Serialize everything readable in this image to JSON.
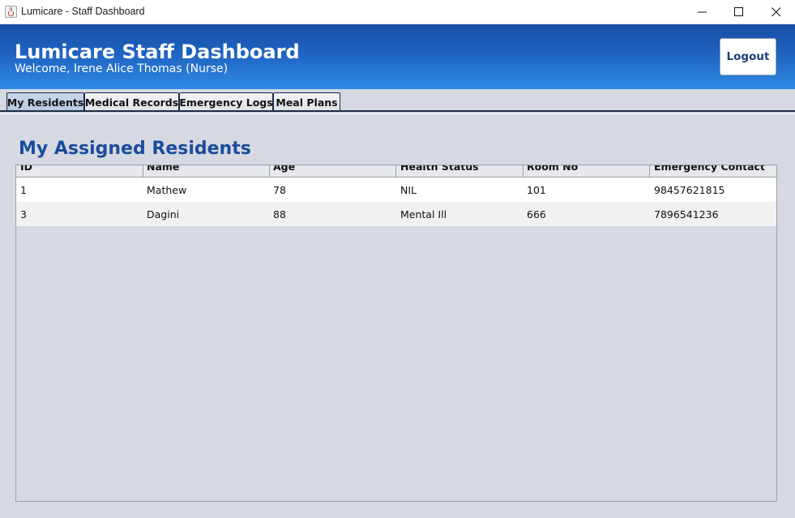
{
  "window": {
    "title": "Lumicare - Staff Dashboard",
    "icon": "java-cup-icon"
  },
  "header": {
    "title": "Lumicare Staff Dashboard",
    "welcome": "Welcome, Irene Alice Thomas (Nurse)",
    "logout_label": "Logout"
  },
  "tabs": [
    {
      "label": "My Residents",
      "active": true
    },
    {
      "label": "Medical Records",
      "active": false
    },
    {
      "label": "Emergency Logs",
      "active": false
    },
    {
      "label": "Meal Plans",
      "active": false
    }
  ],
  "main": {
    "section_title": "My Assigned Residents",
    "table": {
      "columns": [
        "ID",
        "Name",
        "Age",
        "Health Status",
        "Room No",
        "Emergency Contact"
      ],
      "rows": [
        [
          "1",
          "Mathew",
          "78",
          "NIL",
          "101",
          "98457621815"
        ],
        [
          "3",
          "Dagini",
          "88",
          "Mental Ill",
          "666",
          "7896541236"
        ]
      ]
    }
  },
  "colors": {
    "header_gradient_top": "#174ea6",
    "header_gradient_bottom": "#2f8be6",
    "section_title": "#1a4c9c",
    "background": "#d6d9e1"
  }
}
